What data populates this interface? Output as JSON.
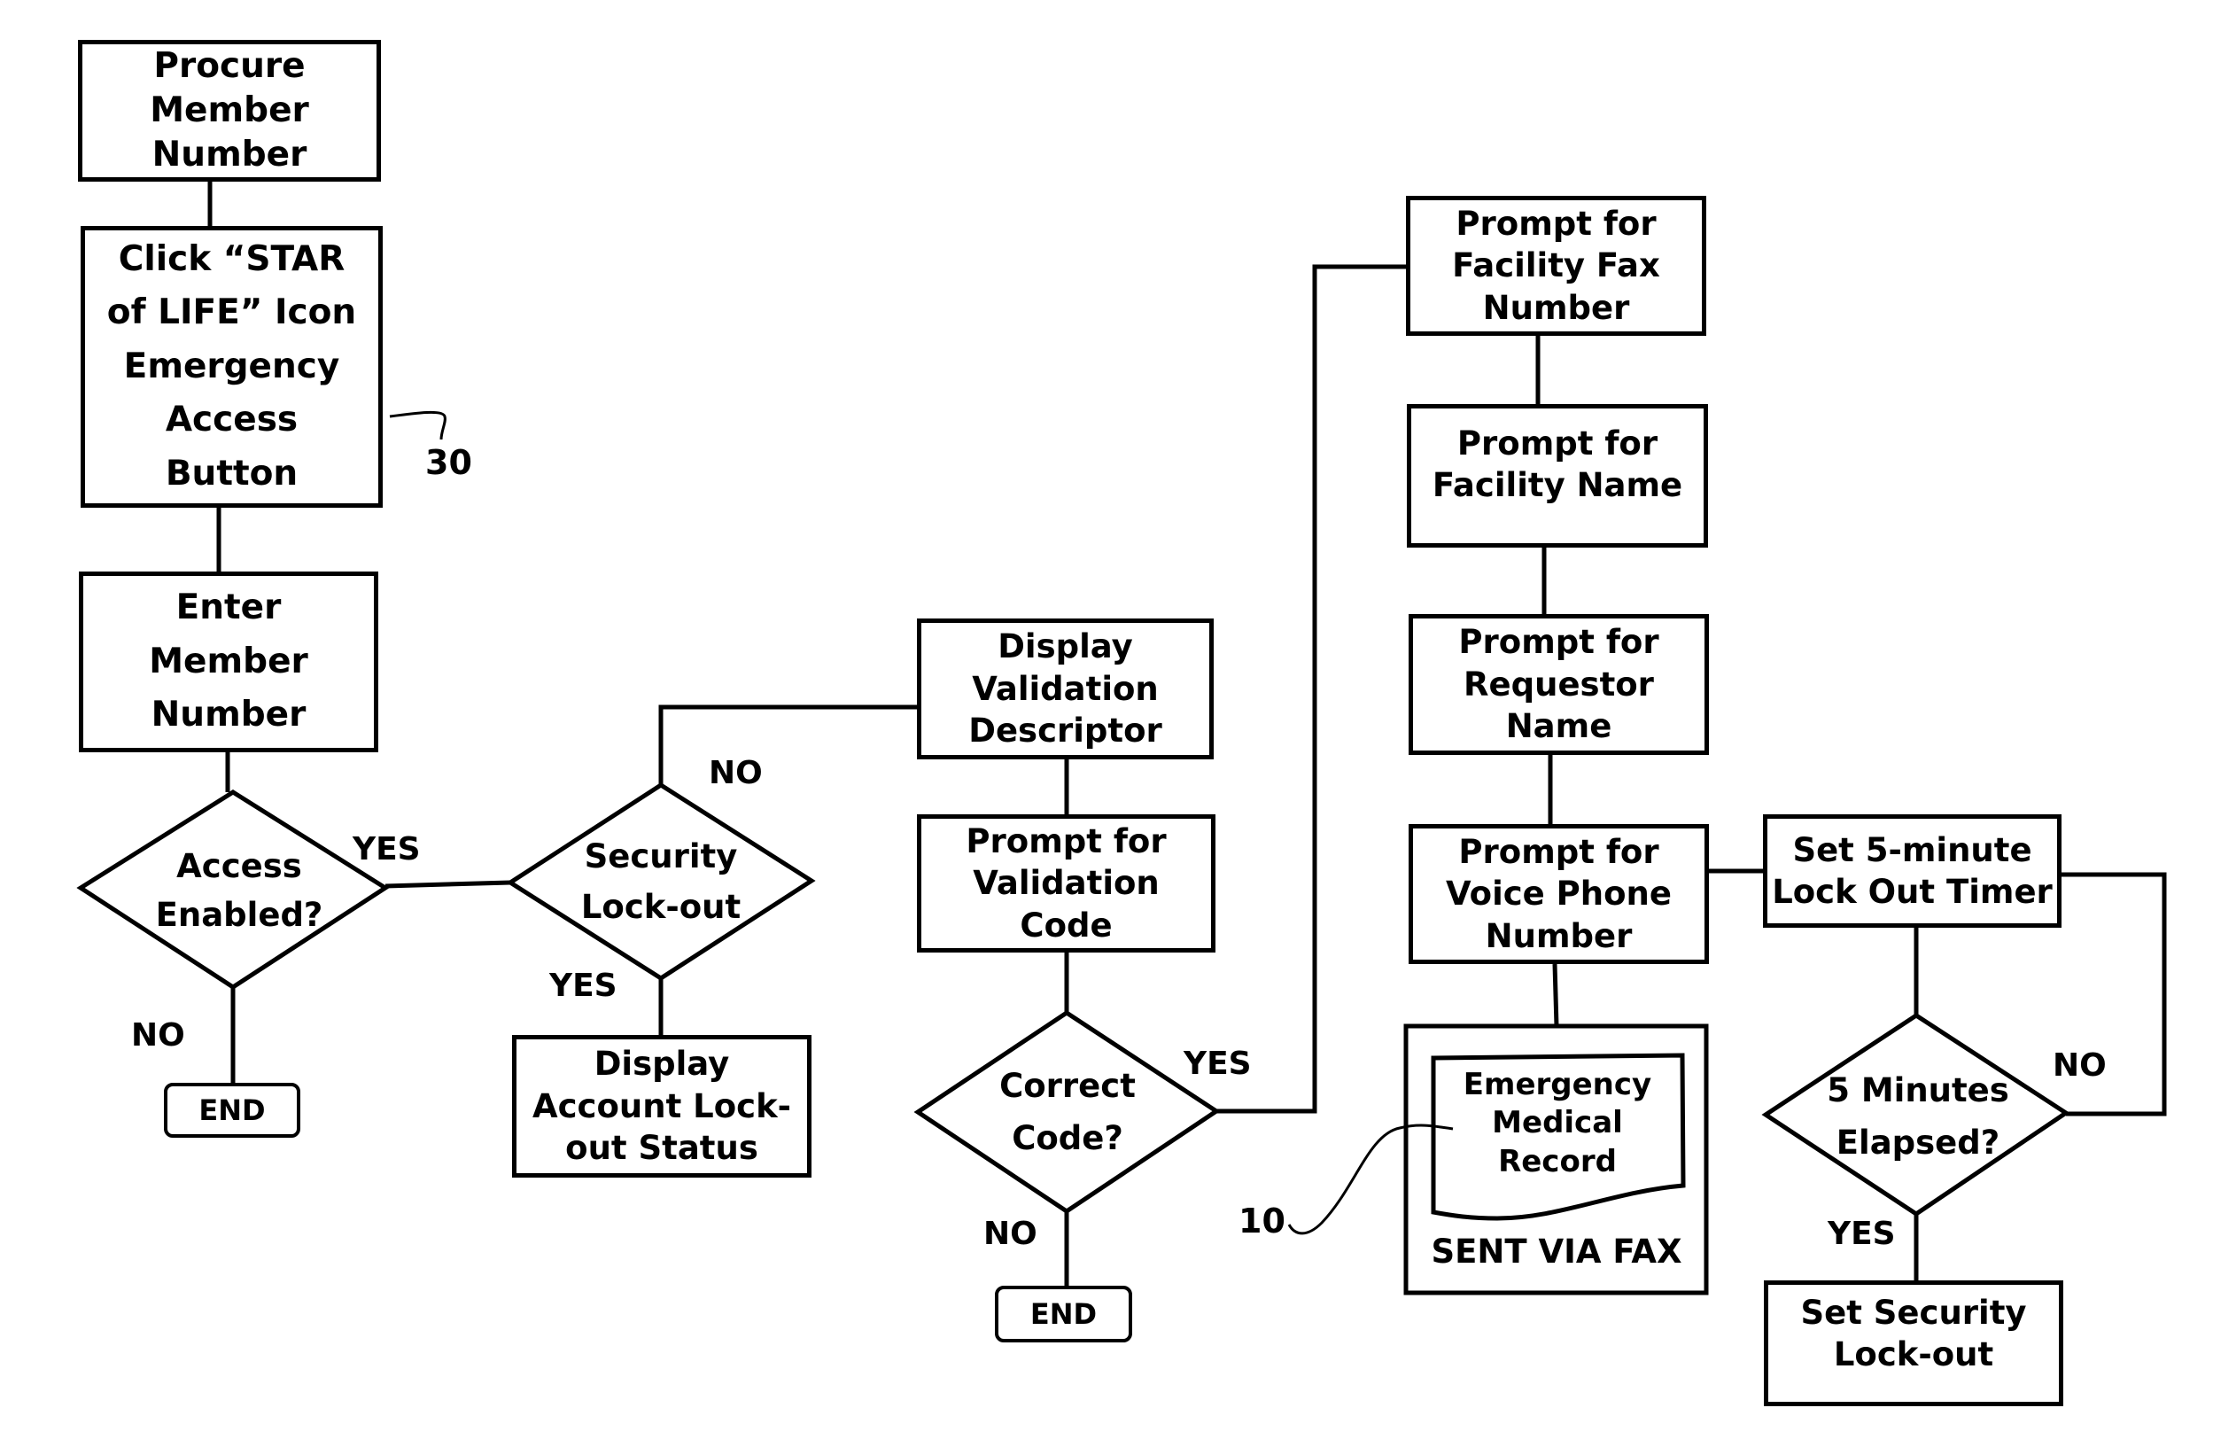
{
  "diagram": {
    "type": "flowchart",
    "colors": {
      "stroke": "#000000",
      "background": "#ffffff"
    },
    "nodes": {
      "procure": {
        "lines": [
          "Procure",
          "Member",
          "Number"
        ]
      },
      "click_star": {
        "lines": [
          "Click “STAR",
          "of LIFE” Icon",
          "Emergency",
          "Access",
          "Button"
        ]
      },
      "enter_member": {
        "lines": [
          "Enter",
          "Member",
          "Number"
        ]
      },
      "access_enabled": {
        "lines": [
          "Access",
          "Enabled?"
        ]
      },
      "end_1": {
        "lines": [
          "END"
        ]
      },
      "security_lockout": {
        "lines": [
          "Security",
          "Lock-out"
        ]
      },
      "display_account": {
        "lines": [
          "Display",
          "Account Lock-",
          "out Status"
        ]
      },
      "display_validation": {
        "lines": [
          "Display",
          "Validation",
          "Descriptor"
        ]
      },
      "prompt_validation": {
        "lines": [
          "Prompt for",
          "Validation",
          "Code"
        ]
      },
      "correct_code": {
        "lines": [
          "Correct",
          "Code?"
        ]
      },
      "end_2": {
        "lines": [
          "END"
        ]
      },
      "prompt_fax": {
        "lines": [
          "Prompt for",
          "Facility Fax",
          "Number"
        ]
      },
      "prompt_facility_name": {
        "lines": [
          "Prompt for",
          "Facility Name"
        ]
      },
      "prompt_requestor": {
        "lines": [
          "Prompt for",
          "Requestor",
          "Name"
        ]
      },
      "prompt_voice": {
        "lines": [
          "Prompt for",
          "Voice Phone",
          "Number"
        ]
      },
      "emergency_record": {
        "lines": [
          "Emergency",
          "Medical",
          "Record"
        ]
      },
      "sent_via_fax": {
        "lines": [
          "SENT VIA FAX"
        ]
      },
      "set_timer": {
        "lines": [
          "Set 5-minute",
          "Lock Out Timer"
        ]
      },
      "five_minutes": {
        "lines": [
          "5 Minutes",
          "Elapsed?"
        ]
      },
      "set_security": {
        "lines": [
          "Set Security",
          "Lock-out"
        ]
      }
    },
    "edge_labels": {
      "access_yes": "YES",
      "access_no": "NO",
      "security_no": "NO",
      "security_yes": "YES",
      "correct_yes": "YES",
      "correct_no": "NO",
      "five_no": "NO",
      "five_yes": "YES"
    },
    "reference_numerals": {
      "ref_30": "30",
      "ref_10": "10"
    }
  }
}
